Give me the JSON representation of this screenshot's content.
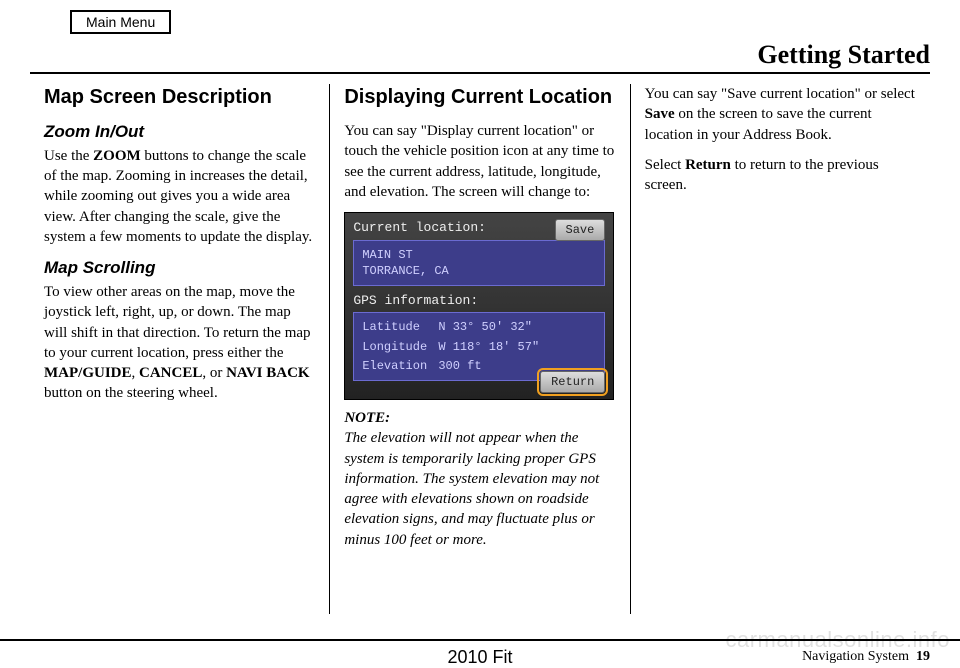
{
  "header": {
    "main_menu": "Main Menu",
    "section_title": "Getting Started"
  },
  "col1": {
    "h1": "Map Screen Description",
    "zoom": {
      "title": "Zoom In/Out",
      "pre": "Use the ",
      "bold": "ZOOM",
      "post": " buttons to change the scale of the map. Zooming in increases the detail, while zooming out gives you a wide area view. After changing the scale, give the system a few moments to update the display."
    },
    "scroll": {
      "title": "Map Scrolling",
      "pre": "To view other areas on the map, move the joystick left, right, up, or down. The map will shift in that direction. To return the map to your current location, press either the ",
      "b1": "MAP/GUIDE",
      "mid1": ", ",
      "b2": "CANCEL",
      "mid2": ", or ",
      "b3": "NAVI BACK",
      "post": " button on the steering wheel."
    }
  },
  "col2": {
    "h1": "Displaying Current Location",
    "intro": "You can say \"Display current location\" or touch the vehicle position icon at any time to see the current address, latitude, longitude, and elevation. The screen will change to:",
    "gps": {
      "title_label": "Current location:",
      "addr1": "MAIN ST",
      "addr2": "TORRANCE, CA",
      "info_label": "GPS information:",
      "lat_label": "Latitude",
      "lat_val": "N  33° 50' 32\"",
      "lon_label": "Longitude",
      "lon_val": "W 118° 18' 57\"",
      "ele_label": "Elevation",
      "ele_val": "300 ft",
      "save_btn": "Save",
      "return_btn": "Return"
    },
    "note_label": "NOTE:",
    "note_body": "The elevation will not appear when the system is temporarily lacking proper GPS information. The system elevation may not agree with elevations shown on roadside elevation signs, and may fluctuate plus or minus 100 feet or more."
  },
  "col3": {
    "p1_pre": "You can say \"Save current location\" or select ",
    "p1_bold": "Save",
    "p1_post": " on the screen to save the current location in your Address Book.",
    "p2_pre": "Select ",
    "p2_bold": "Return",
    "p2_post": " to return to the previous screen."
  },
  "footer": {
    "model": "2010 Fit",
    "right_label": "Navigation System",
    "page_num": "19"
  },
  "watermark": "carmanualsonline.info"
}
